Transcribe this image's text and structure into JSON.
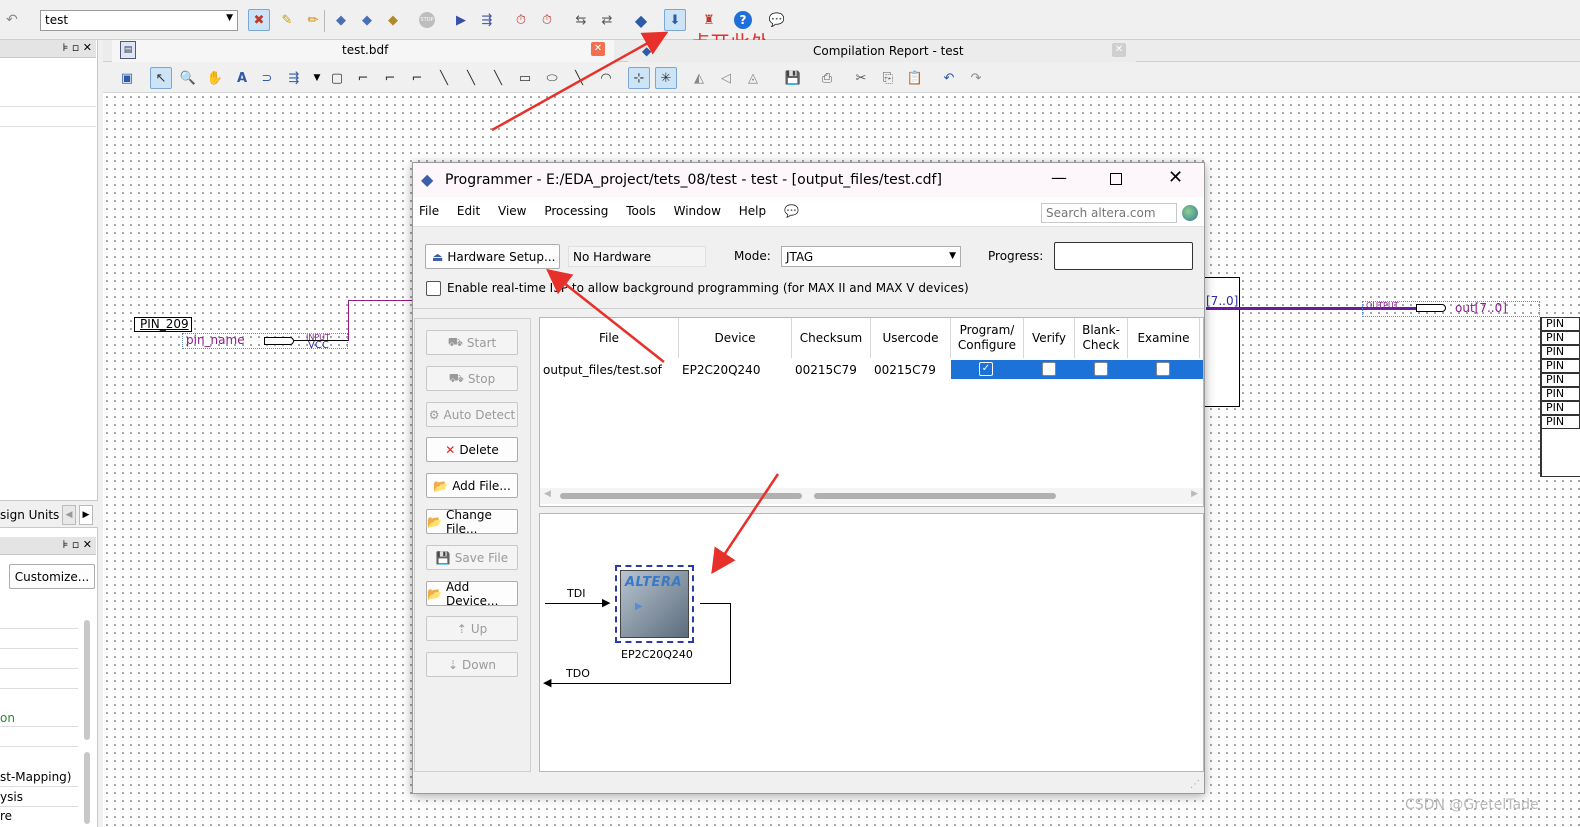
{
  "top_toolbar": {
    "project_combo": "test",
    "icons": [
      "undo-icon",
      "analysis-icon",
      "wand-icon",
      "pencil-icon",
      "compile-icon",
      "analysis-synthesis-icon",
      "fitter-icon",
      "stop-icon",
      "play-icon",
      "timing-icon",
      "clock-icon",
      "timer-icon",
      "netlist-icon",
      "rtl-icon",
      "chip-planner-icon",
      "programmer-icon",
      "signaltap-icon",
      "help-icon",
      "chat-icon"
    ]
  },
  "annotation": {
    "text": "点开此处",
    "color": "#e8302a"
  },
  "tabs": [
    {
      "label": "test.bdf"
    },
    {
      "label": "Compilation Report - test"
    }
  ],
  "left_panel": {
    "design_units_label": "sign Units",
    "customize_button": "Customize...",
    "list_items": [
      "on",
      "st-Mapping)",
      "ysis",
      "re"
    ]
  },
  "schematic": {
    "pin_left_label": "PIN_209",
    "pin_name": "pin_name",
    "input_label": "INPUT",
    "vcc_label": "VCC",
    "bus_label": "[7..0]",
    "output_label": "OUTPUT",
    "out_label": "out[7..0]",
    "pin_right_labels": [
      "PIN",
      "PIN",
      "PIN",
      "PIN",
      "PIN",
      "PIN",
      "PIN",
      "PIN"
    ]
  },
  "programmer": {
    "title": "Programmer - E:/EDA_project/tets_08/test - test - [output_files/test.cdf]",
    "menu": [
      "File",
      "Edit",
      "View",
      "Processing",
      "Tools",
      "Window",
      "Help"
    ],
    "search_placeholder": "Search altera.com",
    "hardware_setup_button": "Hardware Setup...",
    "hardware_value": "No Hardware",
    "mode_label": "Mode:",
    "mode_value": "JTAG",
    "progress_label": "Progress:",
    "isp_checkbox_label": "Enable real-time ISP to allow background programming (for MAX II and MAX V devices)",
    "side_buttons": [
      {
        "label": "Start",
        "enabled": false
      },
      {
        "label": "Stop",
        "enabled": false
      },
      {
        "label": "Auto Detect",
        "enabled": false
      },
      {
        "label": "Delete",
        "enabled": true
      },
      {
        "label": "Add File...",
        "enabled": true
      },
      {
        "label": "Change File...",
        "enabled": true
      },
      {
        "label": "Save File",
        "enabled": false
      },
      {
        "label": "Add Device...",
        "enabled": true
      },
      {
        "label": "Up",
        "enabled": false
      },
      {
        "label": "Down",
        "enabled": false
      }
    ],
    "table": {
      "columns": [
        "File",
        "Device",
        "Checksum",
        "Usercode",
        "Program/\nConfigure",
        "Verify",
        "Blank-\nCheck",
        "Examine"
      ],
      "rows": [
        {
          "file": "output_files/test.sof",
          "device": "EP2C20Q240",
          "checksum": "00215C79",
          "usercode": "00215C79",
          "program": true,
          "verify": false,
          "blank_check": false,
          "examine": false
        }
      ]
    },
    "chain": {
      "tdi_label": "TDI",
      "tdo_label": "TDO",
      "chip_logo": "ALTERA",
      "device_label": "EP2C20Q240"
    }
  },
  "watermark": "CSDN @GretelTade"
}
